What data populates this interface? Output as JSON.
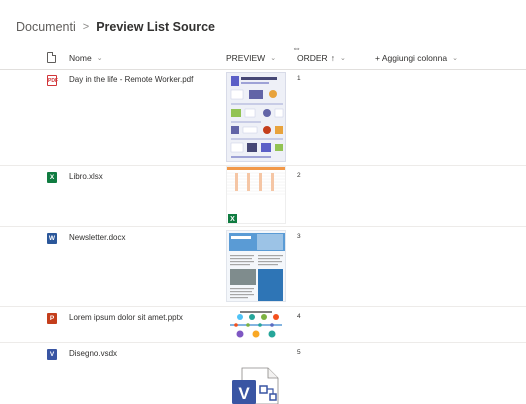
{
  "breadcrumb": {
    "root": "Documenti",
    "separator": ">",
    "current": "Preview List Source"
  },
  "columns": {
    "name": "Nome",
    "preview": "PREVIEW",
    "order": "ORDER",
    "order_sort_indicator": "↑",
    "add": "+ Aggiungi colonna"
  },
  "files": [
    {
      "name": "Day in the life - Remote Worker.pdf",
      "order": "1",
      "icon": "pdf-icon"
    },
    {
      "name": "Libro.xlsx",
      "order": "2",
      "icon": "excel-icon"
    },
    {
      "name": "Newsletter.docx",
      "order": "3",
      "icon": "word-icon"
    },
    {
      "name": "Lorem ipsum dolor sit amet.pptx",
      "order": "4",
      "icon": "powerpoint-icon"
    },
    {
      "name": "Disegno.vsdx",
      "order": "5",
      "icon": "visio-icon"
    }
  ],
  "colors": {
    "pdf": "#d13438",
    "excel": "#107c41",
    "word": "#2b579a",
    "powerpoint": "#c43e1c",
    "visio": "#3955a3"
  }
}
